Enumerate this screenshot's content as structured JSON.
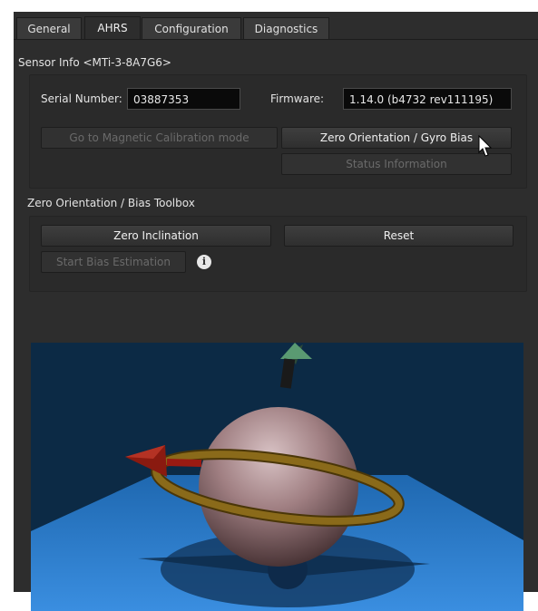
{
  "tabs": [
    {
      "label": "General"
    },
    {
      "label": "AHRS"
    },
    {
      "label": "Configuration"
    },
    {
      "label": "Diagnostics"
    }
  ],
  "sensor_info": {
    "heading": "Sensor Info <MTi-3-8A7G6>",
    "serial_label": "Serial Number:",
    "serial_value": "03887353",
    "firmware_label": "Firmware:",
    "firmware_value": "1.14.0 (b4732 rev111195)",
    "mag_cal_button": "Go to Magnetic Calibration mode",
    "zero_orientation_button": "Zero Orientation / Gyro Bias",
    "status_button": "Status Information"
  },
  "toolbox": {
    "heading": "Zero Orientation / Bias Toolbox",
    "zero_inclination_button": "Zero Inclination",
    "reset_button": "Reset",
    "start_bias_button": "Start Bias Estimation",
    "info_icon": "i"
  },
  "colors": {
    "panel_bg": "#2d2d2d",
    "sky": "#0c2a45",
    "floor": "#2a7fd0",
    "sphere": "#a07f82",
    "ring": "#8a6a1a",
    "arrow_red": "#9a1a12",
    "arrow_green": "#5a9a72"
  }
}
